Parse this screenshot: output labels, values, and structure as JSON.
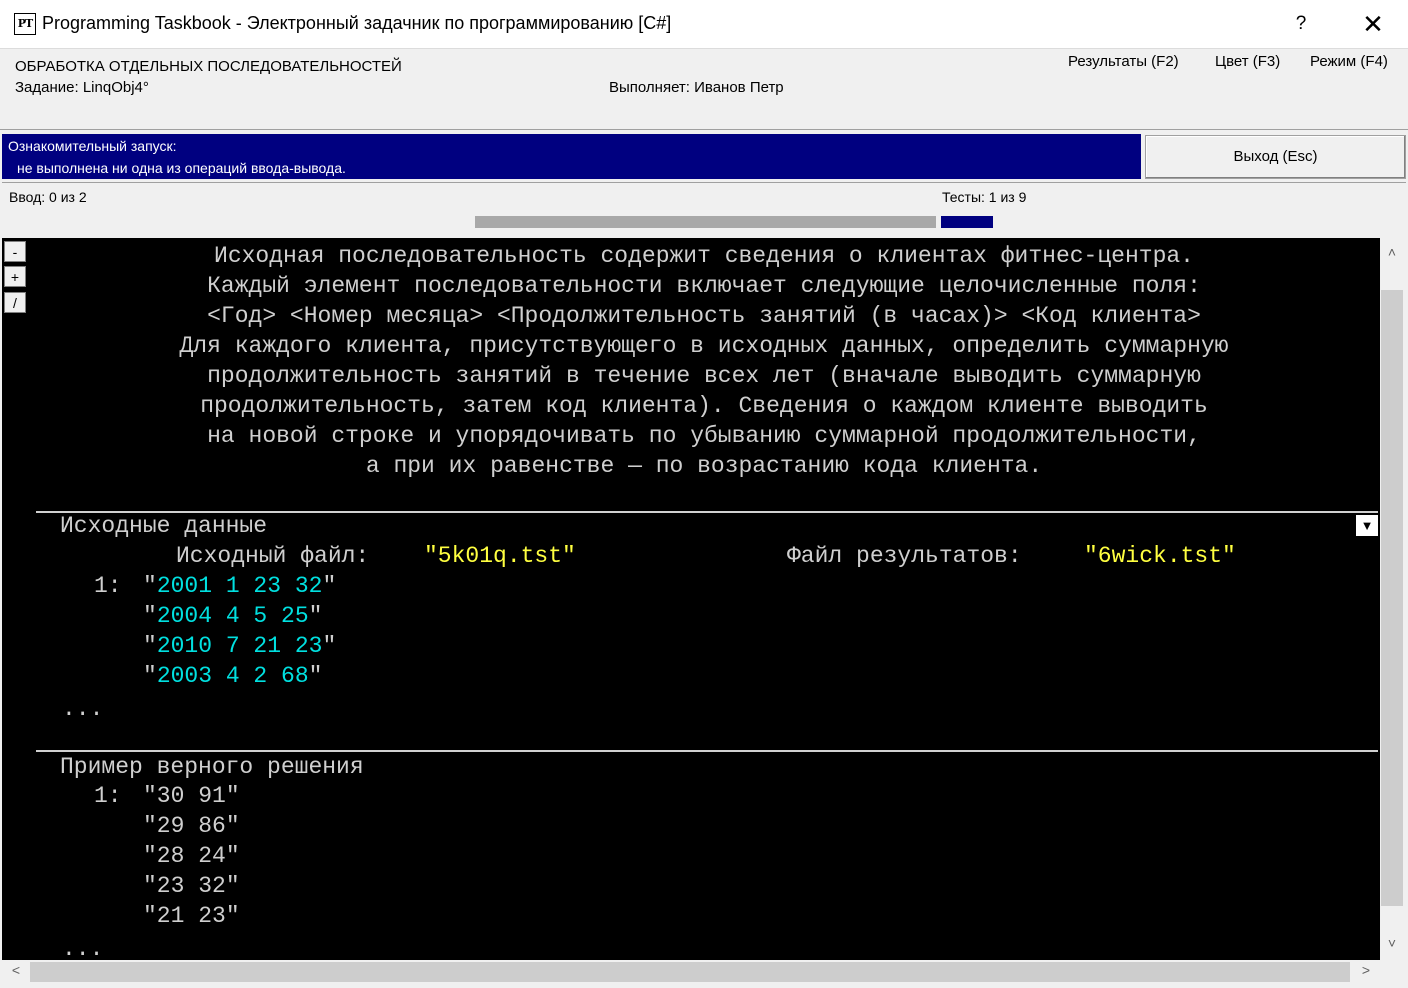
{
  "window": {
    "icon_text": "PT",
    "title": "Programming Taskbook - Электронный задачник по программированию [C#]",
    "help": "?",
    "close": "✕"
  },
  "header": {
    "group_title": "ОБРАБОТКА ОТДЕЛЬНЫХ ПОСЛЕДОВАТЕЛЬНОСТЕЙ",
    "task": "Задание: LinqObj4°",
    "performer": "Выполняет: Иванов Петр",
    "menu": {
      "results": "Результаты (F2)",
      "color": "Цвет (F3)",
      "mode": "Режим (F4)"
    }
  },
  "status": {
    "line1": "Ознакомительный запуск:",
    "line2": "не выполнена ни одна из операций ввода-вывода.",
    "exit_button": "Выход (Esc)"
  },
  "io": {
    "input": "Ввод:  0 из 2",
    "tests": "Тесты:  1 из 9",
    "tests_progress": 0.111
  },
  "side_buttons": {
    "minus": "-",
    "plus": "+",
    "slash": "/"
  },
  "description": [
    "Исходная последовательность содержит сведения о клиентах фитнес-центра.",
    "Каждый элемент последовательности включает следующие целочисленные поля:",
    "<Год> <Номер месяца> <Продолжительность занятий (в часах)> <Код клиента>",
    "Для каждого клиента, присутствующего в исходных данных, определить суммарную",
    "продолжительность занятий в течение всех лет (вначале выводить суммарную",
    "продолжительность, затем код клиента). Сведения о каждом клиенте выводить",
    "на новой строке и упорядочивать по убыванию суммарной продолжительности,",
    "а при их равенстве — по возрастанию кода клиента."
  ],
  "input_section": {
    "title": "Исходные данные",
    "file_label": "Исходный файл: ",
    "file_name": "\"5k01q.tst\"",
    "result_label": "Файл результатов: ",
    "result_name": "\"6wick.tst\"",
    "row_index": "1:",
    "rows": [
      "2001 1 23 32",
      "2004 4 5 25",
      "2010 7 21 23",
      "2003 4 2 68"
    ],
    "ellipsis": "...",
    "dropdown": "▼"
  },
  "sample_section": {
    "title": "Пример верного решения",
    "row_index": "1:",
    "rows": [
      "\"30 91\"",
      "\"29 86\"",
      "\"28 24\"",
      "\"23 32\"",
      "\"21 23\""
    ],
    "ellipsis": "..."
  },
  "scroll": {
    "up": "˄",
    "down": "˅",
    "left": "<",
    "right": ">"
  }
}
